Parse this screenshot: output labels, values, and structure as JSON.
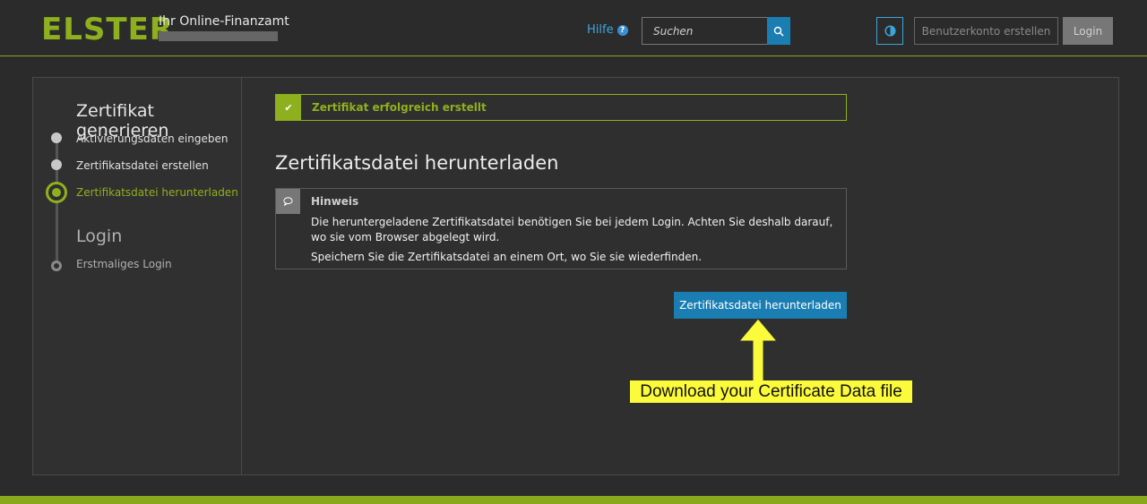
{
  "header": {
    "logo": "ELSTER",
    "tagline": "Ihr Online-Finanzamt",
    "help_label": "Hilfe",
    "help_icon": "question-circle-icon",
    "search_placeholder": "Suchen",
    "search_icon": "search-icon",
    "contrast_icon": "contrast-icon",
    "account_button": "Benutzerkonto erstellen",
    "login_button": "Login"
  },
  "sidebar": {
    "sections": [
      {
        "title": "Zertifikat generieren",
        "items": [
          {
            "label": "Aktivierungsdaten eingeben",
            "state": "done"
          },
          {
            "label": "Zertifikatsdatei erstellen",
            "state": "done"
          },
          {
            "label": "Zertifikatsdatei herunterladen",
            "state": "active"
          }
        ]
      },
      {
        "title": "Login",
        "items": [
          {
            "label": "Erstmaliges Login",
            "state": "pending"
          }
        ]
      }
    ]
  },
  "main": {
    "success_message": "Zertifikat erfolgreich erstellt",
    "success_icon": "check-icon",
    "title": "Zertifikatsdatei herunterladen",
    "hint": {
      "icon": "speech-bubble-icon",
      "title": "Hinweis",
      "paragraph1": "Die heruntergeladene Zertifikatsdatei benötigen Sie bei jedem Login. Achten Sie deshalb darauf, wo sie vom Browser abgelegt wird.",
      "paragraph2": "Speichern Sie die Zertifikatsdatei an einem Ort, wo Sie sie wiederfinden."
    },
    "download_button": "Zertifikatsdatei herunterladen"
  },
  "annotation": {
    "callout_text": "Download your Certificate Data file",
    "callout_color": "#fbfb3c"
  },
  "colors": {
    "brand_green": "#8fb01e",
    "primary_blue": "#1b7eb3",
    "background": "#2b2b2b"
  }
}
